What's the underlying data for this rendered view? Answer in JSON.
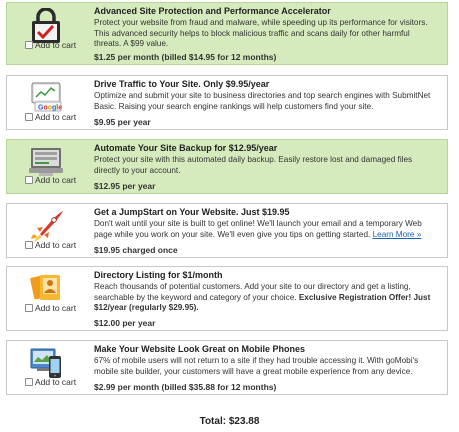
{
  "cart_label": "Add to cart",
  "offers": [
    {
      "title": "Advanced Site Protection and Performance Accelerator",
      "desc": "Protect your website from fraud and malware, while speeding up its performance for visitors. This advanced security helps to block malicious traffic and scans daily for other harmful threats. A $99 value.",
      "price": "$1.25 per month (billed $14.95 for 12 months)",
      "icon": "lock-checkmark-icon",
      "selected": true
    },
    {
      "title": "Drive Traffic to Your Site. Only $9.95/year",
      "desc": "Optimize and submit your site to business directories and top search engines with SubmitNet Basic. Raising your search engine rankings will help customers find your site.",
      "price": "$9.95 per year",
      "icon": "search-engine-icon",
      "selected": false
    },
    {
      "title": "Automate Your Site Backup for $12.95/year",
      "desc": "Protect your site with this automated daily backup. Easily restore lost and damaged files directly to your account.",
      "price": "$12.95 per year",
      "icon": "backup-server-icon",
      "selected": true
    },
    {
      "title": "Get a JumpStart on Your Website. Just $19.95",
      "desc": "Don't wait until your site is built to get online! We'll launch your email and a temporary Web page while you work on your site. We'll even give you tips on getting started.",
      "link": "Learn More »",
      "price": "$19.95 charged once",
      "icon": "rocket-icon",
      "selected": false
    },
    {
      "title": "Directory Listing for $1/month",
      "desc": "Reach thousands of potential customers. Add your site to our directory and get a listing, searchable by the keyword and category of your choice.",
      "desc_bold": "Exclusive Registration Offer! Just $12/year (regularly $29.95).",
      "price": "$12.00 per year",
      "icon": "directory-photos-icon",
      "selected": false
    },
    {
      "title": "Make Your Website Look Great on Mobile Phones",
      "desc": "67% of mobile users will not return to a site if they had trouble accessing it. With goMobi's mobile site builder, your customers will have a great mobile experience from any device.",
      "price": "$2.99 per month (billed $35.88 for 12 months)",
      "icon": "mobile-phone-icon",
      "selected": false
    }
  ],
  "total": "Total: $23.88"
}
